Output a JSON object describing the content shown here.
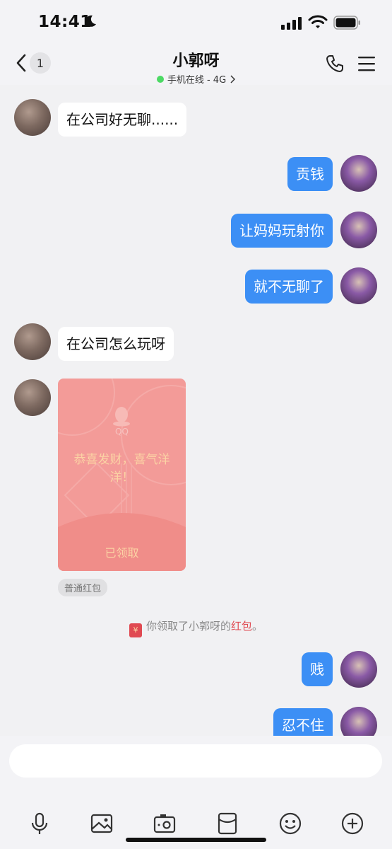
{
  "status_bar": {
    "time": "14:41"
  },
  "header": {
    "unread_count": "1",
    "contact_name": "小郭呀",
    "presence": "手机在线 - 4G"
  },
  "messages": [
    {
      "side": "in",
      "text": "在公司好无聊......"
    },
    {
      "side": "out",
      "text": "贡钱"
    },
    {
      "side": "out",
      "text": "让妈妈玩射你"
    },
    {
      "side": "out",
      "text": "就不无聊了"
    },
    {
      "side": "in",
      "text": "在公司怎么玩呀"
    },
    {
      "side": "out",
      "text": "贱"
    },
    {
      "side": "out",
      "text": "忍不住"
    }
  ],
  "red_packet": {
    "logo_text": "QQ",
    "greeting": "恭喜发财，喜气洋洋！",
    "status": "已领取",
    "type_tag": "普通红包"
  },
  "system_message": {
    "prefix": "你领取了小郭呀的",
    "link": "红包",
    "suffix": "。"
  },
  "icons": {
    "back": "chevron-left-icon",
    "call": "phone-icon",
    "menu": "menu-icon",
    "toolbar": [
      "microphone-icon",
      "image-icon",
      "camera-icon",
      "red-packet-icon",
      "emoji-icon",
      "plus-icon"
    ]
  },
  "colors": {
    "outgoing_bubble": "#3c8ff5",
    "incoming_bubble": "#ffffff",
    "red_packet": "#f39b98",
    "online_dot": "#4cd964"
  }
}
